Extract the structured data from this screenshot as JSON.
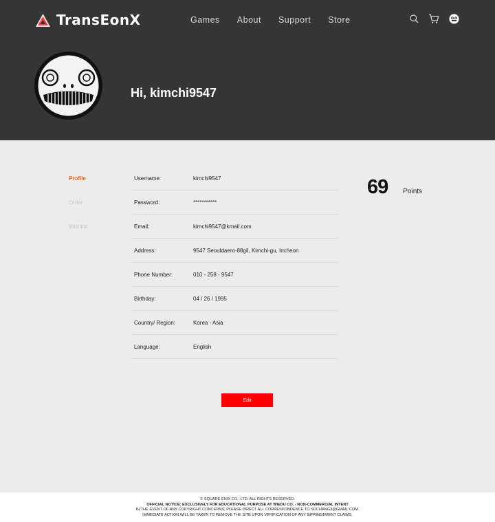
{
  "header": {
    "brand": "TransEonX",
    "nav": [
      "Games",
      "About",
      "Support",
      "Store"
    ],
    "icons": [
      "search-icon",
      "cart-icon",
      "user-avatar-icon"
    ]
  },
  "profile": {
    "greeting": "Hi, kimchi9547"
  },
  "sidebar": {
    "items": [
      {
        "label": "Profile",
        "active": true
      },
      {
        "label": "Order",
        "active": false
      },
      {
        "label": "Wishlist",
        "active": false
      }
    ]
  },
  "info": [
    {
      "key": "Username:",
      "value": "kimchi9547"
    },
    {
      "key": "Password:",
      "value": "***********"
    },
    {
      "key": "Email:",
      "value": "kimchi9547@kmail.com"
    },
    {
      "key": "Address:",
      "value": "9547 Seouldaero-88gil, Kimchi-gu, Incheon"
    },
    {
      "key": "Phone Number:",
      "value": "010 - 258 - 9547"
    },
    {
      "key": "Birthday:",
      "value": "04 / 26 / 1995"
    },
    {
      "key": "Country/ Region:",
      "value": "Korea - Asia"
    },
    {
      "key": "Language:",
      "value": "English"
    }
  ],
  "points": {
    "value": "69",
    "label": "Points"
  },
  "actions": {
    "edit_label": "Edit"
  },
  "footer": {
    "lines": [
      "© SQUARE ENIX CO., LTD. ALL RIGHTS RESERVED.",
      "OFFICIAL NOTICE: EXCLUSIVELY FOR EDUCATIONAL PURPOSE AT WIEDU CO. - NON-COMMERCIAL INTENT",
      "IN THE EVENT OF ANY COPYRIGHT CONCERNS, PLEASE DIRECT ALL CORRESPONDENCE TO SDCHANG3@GMAIL.COM.",
      "IMMEDIATE ACTION WILL BE TAKEN TO REMOVE THE SITE UPON VERIFICATION OF ANY INFRINGEMENT CLAIMS."
    ]
  },
  "colors": {
    "header_bg": "#353535",
    "accent": "#f26522",
    "edit_button": "#ff0000",
    "page_bg": "#ececec"
  }
}
